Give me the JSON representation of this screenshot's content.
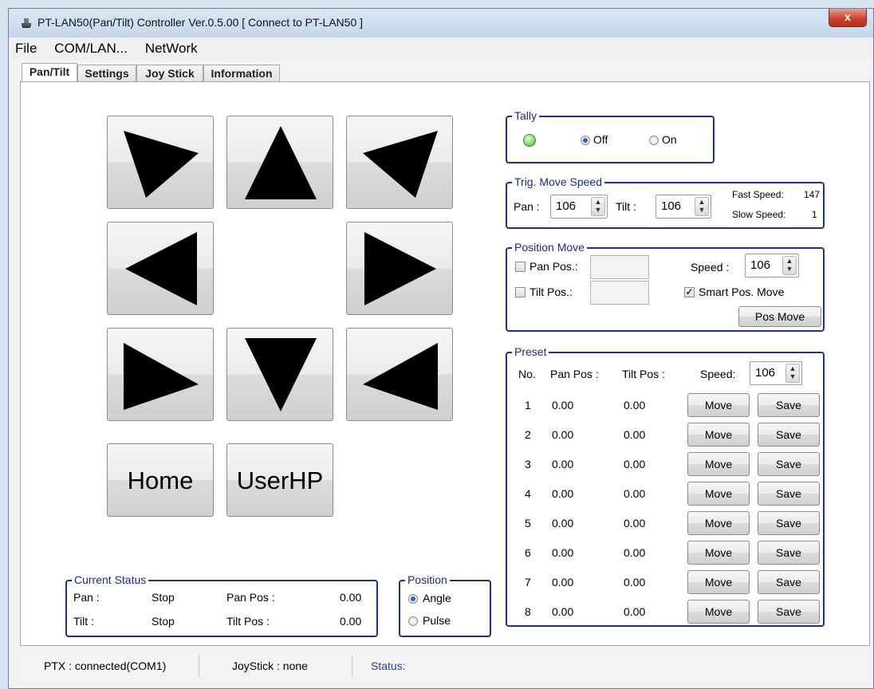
{
  "window": {
    "title": "PT-LAN50(Pan/Tilt) Controller Ver.0.5.00   [ Connect to PT-LAN50  ]",
    "close_label": "x"
  },
  "menu": {
    "items": [
      "File",
      "COM/LAN...",
      "NetWork"
    ]
  },
  "tabs": [
    "Pan/Tilt",
    "Settings",
    "Joy Stick",
    "Information"
  ],
  "pad": {
    "home_label": "Home",
    "userhp_label": "UserHP"
  },
  "tally": {
    "title": "Tally",
    "off_label": "Off",
    "on_label": "On",
    "selected": "Off",
    "led_color": "#7fd86a"
  },
  "trig_speed": {
    "title": "Trig. Move Speed",
    "pan_label": "Pan :",
    "pan_value": "106",
    "tilt_label": "Tilt :",
    "tilt_value": "106",
    "fast_label": "Fast Speed:",
    "fast_value": "147",
    "slow_label": "Slow Speed:",
    "slow_value": "1"
  },
  "position_move": {
    "title": "Position Move",
    "pan_pos_label": "Pan Pos.:",
    "tilt_pos_label": "Tilt Pos.:",
    "speed_label": "Speed :",
    "speed_value": "106",
    "smart_label": "Smart Pos. Move",
    "smart_checked": true,
    "button_label": "Pos Move"
  },
  "preset": {
    "title": "Preset",
    "headers": {
      "no": "No.",
      "pan": "Pan Pos :",
      "tilt": "Tilt Pos :",
      "speed": "Speed:"
    },
    "speed_value": "106",
    "move_label": "Move",
    "save_label": "Save",
    "rows": [
      {
        "no": "1",
        "pan": "0.00",
        "tilt": "0.00"
      },
      {
        "no": "2",
        "pan": "0.00",
        "tilt": "0.00"
      },
      {
        "no": "3",
        "pan": "0.00",
        "tilt": "0.00"
      },
      {
        "no": "4",
        "pan": "0.00",
        "tilt": "0.00"
      },
      {
        "no": "5",
        "pan": "0.00",
        "tilt": "0.00"
      },
      {
        "no": "6",
        "pan": "0.00",
        "tilt": "0.00"
      },
      {
        "no": "7",
        "pan": "0.00",
        "tilt": "0.00"
      },
      {
        "no": "8",
        "pan": "0.00",
        "tilt": "0.00"
      }
    ]
  },
  "current_status": {
    "title": "Current Status",
    "pan_label": "Pan :",
    "pan_state": "Stop",
    "pan_pos_label": "Pan Pos :",
    "pan_pos_value": "0.00",
    "tilt_label": "Tilt :",
    "tilt_state": "Stop",
    "tilt_pos_label": "Tilt Pos :",
    "tilt_pos_value": "0.00"
  },
  "position": {
    "title": "Position",
    "angle_label": "Angle",
    "pulse_label": "Pulse",
    "selected": "Angle"
  },
  "statusbar": {
    "ptx": "PTX : connected(COM1)",
    "joystick": "JoyStick : none",
    "status": "Status:",
    "status_color": "#2a3fb0"
  }
}
